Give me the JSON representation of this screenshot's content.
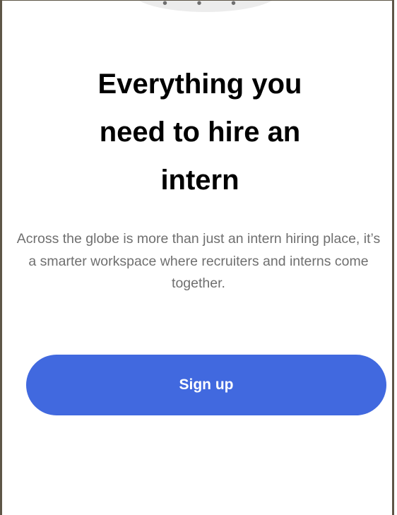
{
  "hero": {
    "title_line1": "Everything you",
    "title_line2": "need to hire an",
    "title_line3": "intern",
    "description": "Across the globe is more than just an intern hiring place, it’s a smarter workspace where recruiters and interns come together."
  },
  "actions": {
    "signup_label": "Sign up"
  },
  "colors": {
    "accent": "#4169df",
    "title": "#000000",
    "body_text": "#6f6f6f",
    "frame_border": "#5e5647"
  }
}
